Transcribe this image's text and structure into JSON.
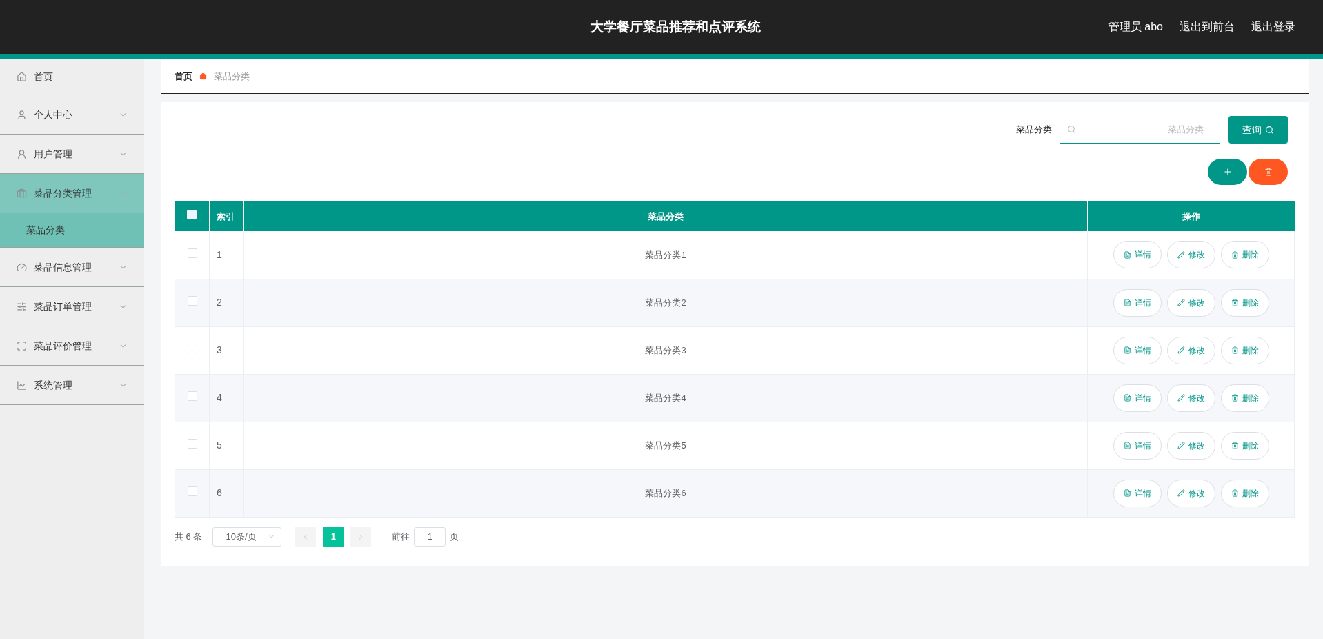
{
  "header": {
    "title": "大学餐厅菜品推荐和点评系统",
    "links": [
      "管理员 abo",
      "退出到前台",
      "退出登录"
    ]
  },
  "sidebar": {
    "items": [
      {
        "label": "首页",
        "has_arrow": false,
        "selected": false
      },
      {
        "label": "个人中心",
        "has_arrow": true,
        "expanded": false,
        "selected": false
      },
      {
        "label": "用户管理",
        "has_arrow": true,
        "expanded": false,
        "selected": false
      },
      {
        "label": "菜品分类管理",
        "has_arrow": true,
        "expanded": true,
        "selected": true,
        "children": [
          {
            "label": "菜品分类",
            "selected": true
          }
        ]
      },
      {
        "label": "菜品信息管理",
        "has_arrow": true,
        "expanded": false,
        "selected": false
      },
      {
        "label": "菜品订单管理",
        "has_arrow": true,
        "expanded": false,
        "selected": false
      },
      {
        "label": "菜品评价管理",
        "has_arrow": true,
        "expanded": false,
        "selected": false
      },
      {
        "label": "系统管理",
        "has_arrow": true,
        "expanded": false,
        "selected": false
      }
    ]
  },
  "breadcrumb": [
    "首页",
    "菜品分类"
  ],
  "search": {
    "label": "菜品分类",
    "placeholder": "菜品分类",
    "button": "查询"
  },
  "table": {
    "columns": [
      "索引",
      "菜品分类",
      "操作"
    ],
    "select_all": false,
    "rows": [
      {
        "index": "1",
        "name": "菜品分类1",
        "checked": false,
        "actions": [
          "详情",
          "修改",
          "删除"
        ]
      },
      {
        "index": "2",
        "name": "菜品分类2",
        "checked": false,
        "actions": [
          "详情",
          "修改",
          "删除"
        ]
      },
      {
        "index": "3",
        "name": "菜品分类3",
        "checked": false,
        "actions": [
          "详情",
          "修改",
          "删除"
        ]
      },
      {
        "index": "4",
        "name": "菜品分类4",
        "checked": false,
        "actions": [
          "详情",
          "修改",
          "删除"
        ]
      },
      {
        "index": "5",
        "name": "菜品分类5",
        "checked": false,
        "actions": [
          "详情",
          "修改",
          "删除"
        ]
      },
      {
        "index": "6",
        "name": "菜品分类6",
        "checked": false,
        "actions": [
          "详情",
          "修改",
          "删除"
        ]
      }
    ]
  },
  "pagination": {
    "total": "共 6 条",
    "page_size": "10条/页",
    "pages": [
      {
        "label": "1",
        "selected": true
      }
    ],
    "goto_label": "前往",
    "goto_value": "1",
    "page_unit": "页"
  }
}
